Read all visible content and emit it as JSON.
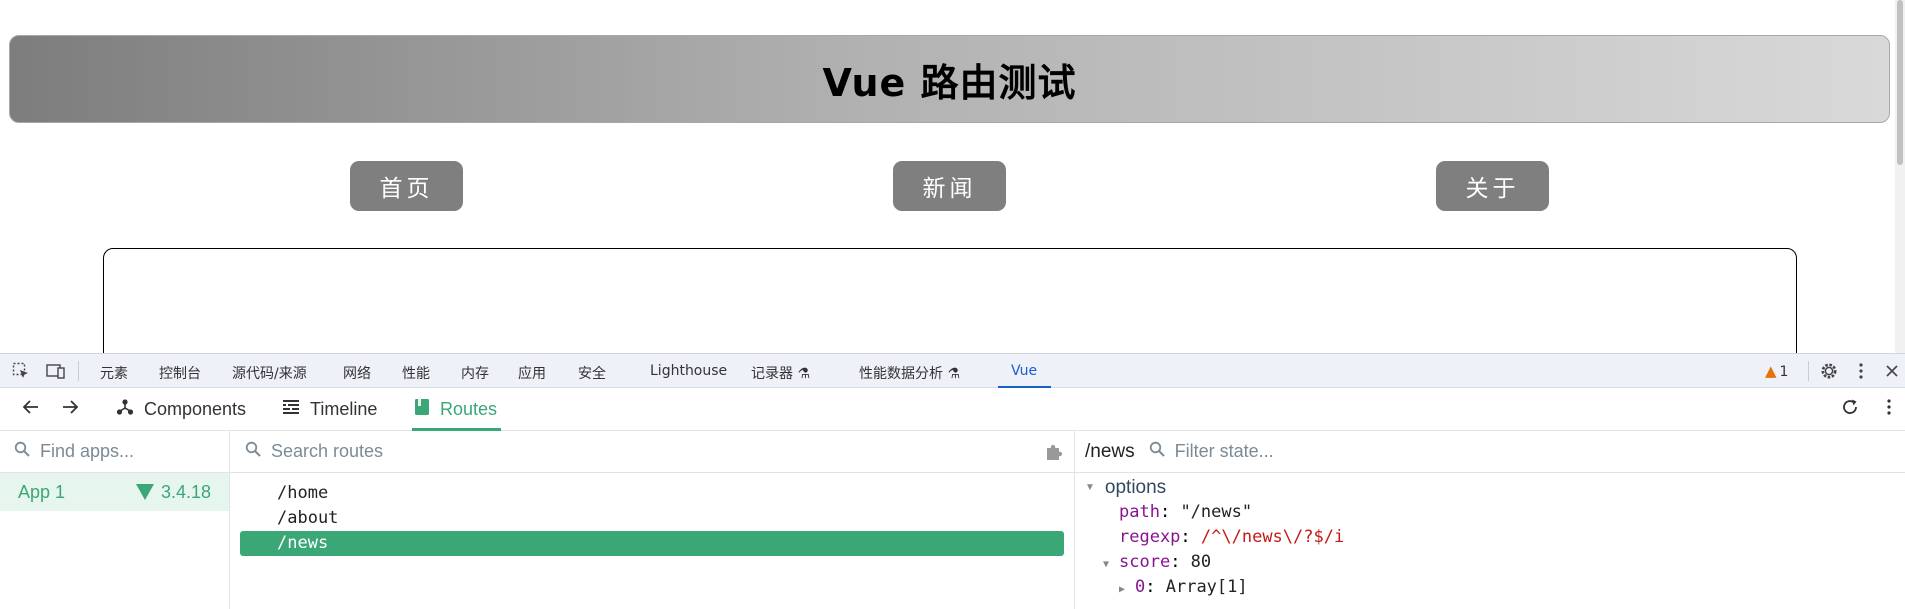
{
  "app": {
    "title": "Vue 路由测试",
    "nav": [
      "首页",
      "新闻",
      "关于"
    ]
  },
  "devtools": {
    "tabs": [
      "元素",
      "控制台",
      "源代码/来源",
      "网络",
      "性能",
      "内存",
      "应用",
      "安全",
      "Lighthouse",
      "记录器",
      "性能数据分析",
      "Vue"
    ],
    "active_tab": "Vue",
    "experimental_icon": "flask-icon",
    "warning_count": "1",
    "vue": {
      "toolbar": {
        "components": "Components",
        "timeline": "Timeline",
        "routes": "Routes",
        "active": "Routes"
      },
      "apps": {
        "search_placeholder": "Find apps...",
        "items": [
          {
            "name": "App 1",
            "version": "3.4.18"
          }
        ]
      },
      "routes": {
        "search_placeholder": "Search routes",
        "items": [
          "/home",
          "/about",
          "/news"
        ],
        "selected": "/news"
      },
      "state": {
        "current_path": "/news",
        "filter_placeholder": "Filter state...",
        "group": "options",
        "path_key": "path",
        "path_value": "\"/news\"",
        "regexp_key": "regexp",
        "regexp_value": "/^\\/news\\/?$/i",
        "score_key": "score",
        "score_value": "80",
        "score_child_key": "0",
        "score_child_value": "Array[1]"
      }
    }
  },
  "colors": {
    "vue_green": "#3ba776",
    "devtools_blue": "#1a5fc7",
    "nav_button": "#7f7f7f"
  }
}
